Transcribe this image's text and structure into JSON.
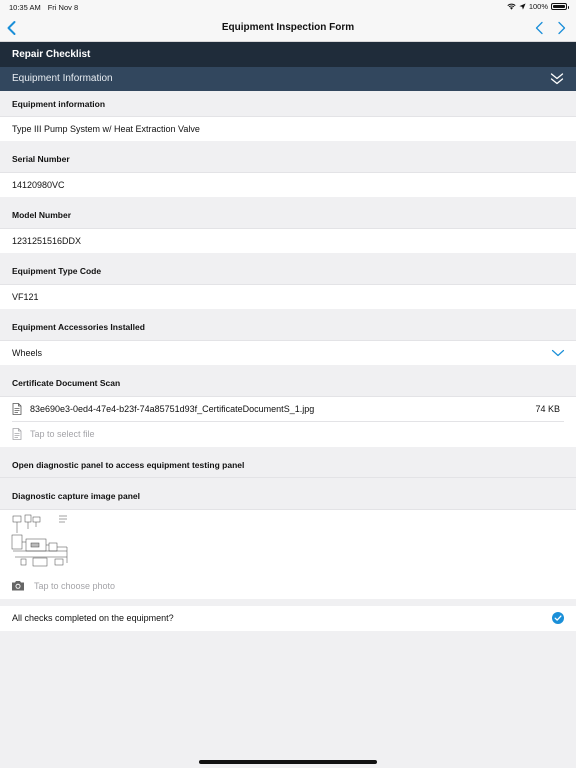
{
  "status_bar": {
    "time": "10:35 AM",
    "date": "Fri Nov 8",
    "battery": "100%",
    "battery_level": 1.0
  },
  "nav": {
    "title": "Equipment Inspection Form"
  },
  "checklist_header": "Repair Checklist",
  "section_header": "Equipment Information",
  "fields": {
    "equipment_info": {
      "label": "Equipment information",
      "value": "Type III Pump System w/ Heat Extraction Valve"
    },
    "serial": {
      "label": "Serial Number",
      "value": "14120980VC"
    },
    "model": {
      "label": "Model Number",
      "value": "1231251516DDX"
    },
    "type_code": {
      "label": "Equipment Type Code",
      "value": "VF121"
    },
    "accessories": {
      "label": "Equipment Accessories Installed",
      "value": "Wheels"
    }
  },
  "certificate": {
    "label": "Certificate Document Scan",
    "file_name": "83e690e3-0ed4-47e4-b23f-74a85751d93f_CertificateDocumentS_1.jpg",
    "file_size": "74 KB",
    "placeholder": "Tap to select file"
  },
  "diagnostic_link": "Open diagnostic panel to access equipment testing panel",
  "diagnostic_image": {
    "label": "Diagnostic capture image panel",
    "placeholder": "Tap to choose photo"
  },
  "all_checks": {
    "label": "All checks completed on the equipment?",
    "checked": true
  },
  "colors": {
    "accent": "#1a8fd8",
    "dark_header": "#1f2c3a",
    "section_header": "#32475e"
  },
  "icons": [
    "back-chevron-icon",
    "previous-chevron-icon",
    "next-chevron-icon",
    "collapse-icon",
    "chevron-down-icon",
    "document-icon",
    "camera-icon",
    "checkmark-icon"
  ]
}
